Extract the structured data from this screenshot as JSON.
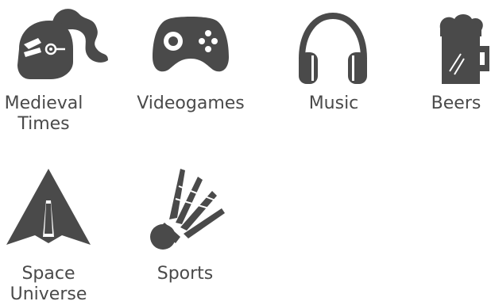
{
  "colors": {
    "icon": "#4a4a4a",
    "label": "#4a4a4a",
    "background": "#ffffff"
  },
  "categories": [
    {
      "label_line1": "Medieval",
      "label_line2": "Times",
      "icon": "knight-helmet-icon"
    },
    {
      "label_line1": "Videogames",
      "label_line2": "",
      "icon": "gamepad-icon"
    },
    {
      "label_line1": "Music",
      "label_line2": "",
      "icon": "headphones-icon"
    },
    {
      "label_line1": "Beers",
      "label_line2": "",
      "icon": "beer-mug-icon"
    },
    {
      "label_line1": "Space",
      "label_line2": "Universe",
      "icon": "rocket-icon"
    },
    {
      "label_line1": "Sports",
      "label_line2": "",
      "icon": "shuttlecock-icon"
    }
  ]
}
